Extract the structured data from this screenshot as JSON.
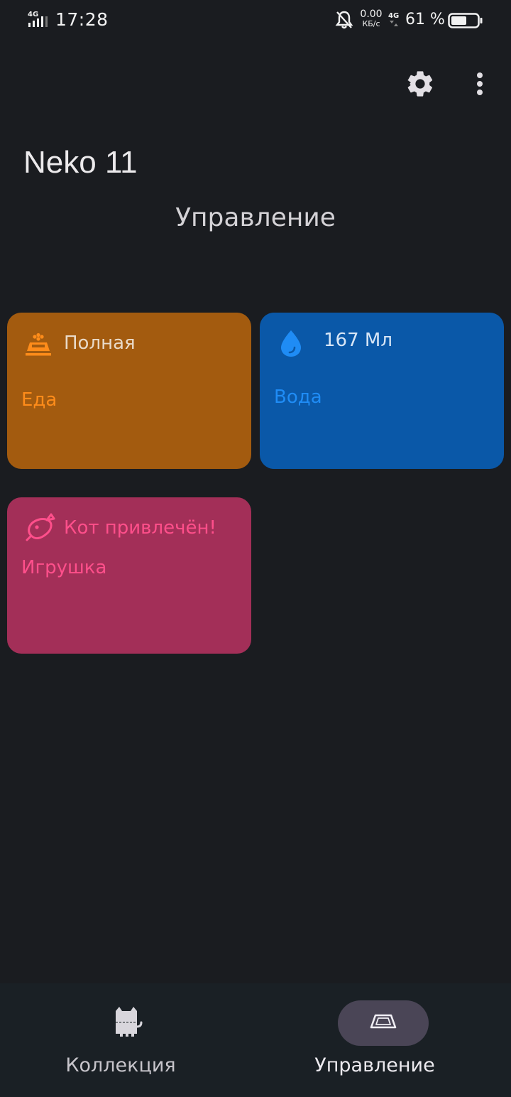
{
  "status_bar": {
    "network_left": "4G",
    "time": "17:28",
    "speed_value": "0.00",
    "speed_unit": "КБ/с",
    "network_right": "4G",
    "battery_percent": "61 %",
    "battery_level": 0.61,
    "icons": [
      "signal-icon",
      "bell-off-icon",
      "signal-icon",
      "battery-icon"
    ]
  },
  "toolbar": {
    "settings_icon": "gear-icon",
    "more_icon": "more-vertical-icon"
  },
  "app_title": "Neko 11",
  "page_title": "Управление",
  "tiles": [
    {
      "id": "food",
      "icon": "food-bowl-icon",
      "status": "Полная",
      "label": "Еда",
      "color": "#a35b0f",
      "accent": "#ff8c1a"
    },
    {
      "id": "water",
      "icon": "water-drop-icon",
      "status": "167 Мл",
      "label": "Вода",
      "color": "#0a58a8",
      "accent": "#1f8cf5"
    },
    {
      "id": "toy",
      "icon": "fish-toy-icon",
      "status": "Кот привлечён!",
      "label": "Игрушка",
      "color": "#a32f58",
      "accent": "#ff4f8b"
    }
  ],
  "bottom_nav": {
    "items": [
      {
        "label": "Коллекция",
        "icon": "cat-icon",
        "selected": false
      },
      {
        "label": "Управление",
        "icon": "bowl-outline-icon",
        "selected": true
      }
    ]
  }
}
